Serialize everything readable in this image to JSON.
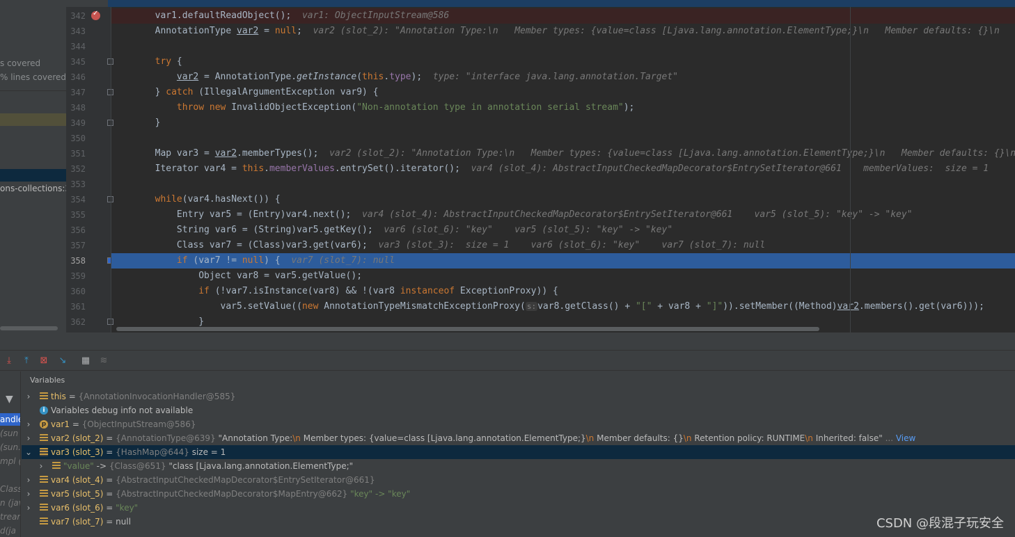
{
  "left_panel": {
    "coverage_lines": [
      "s covered",
      "% lines covered"
    ],
    "library_label": "ons-collections:3."
  },
  "editor": {
    "lines": [
      {
        "num": "342",
        "segments": [
          {
            "t": "        var1.defaultReadObject();  "
          },
          {
            "t": "var1: ObjectInputStream@586",
            "c": "hint"
          }
        ]
      },
      {
        "num": "343",
        "segments": [
          {
            "t": "        AnnotationType "
          },
          {
            "t": "var2",
            "c": "u"
          },
          {
            "t": " = "
          },
          {
            "t": "null",
            "c": "kw"
          },
          {
            "t": ";  "
          },
          {
            "t": "var2 (slot_2): \"Annotation Type:\\n   Member types: {value=class [Ljava.lang.annotation.ElementType;}\\n   Member defaults: {}\\n",
            "c": "hint"
          }
        ]
      },
      {
        "num": "344",
        "segments": [
          {
            "t": ""
          }
        ]
      },
      {
        "num": "345",
        "segments": [
          {
            "t": "        "
          },
          {
            "t": "try",
            "c": "kw"
          },
          {
            "t": " {"
          }
        ]
      },
      {
        "num": "346",
        "segments": [
          {
            "t": "            "
          },
          {
            "t": "var2",
            "c": "u"
          },
          {
            "t": " = AnnotationType."
          },
          {
            "t": "getInstance",
            "c": "ital"
          },
          {
            "t": "("
          },
          {
            "t": "this",
            "c": "kw"
          },
          {
            "t": "."
          },
          {
            "t": "type",
            "c": "field"
          },
          {
            "t": ");  "
          },
          {
            "t": "type: \"interface java.lang.annotation.Target\"",
            "c": "hint"
          }
        ]
      },
      {
        "num": "347",
        "segments": [
          {
            "t": "        } "
          },
          {
            "t": "catch",
            "c": "kw"
          },
          {
            "t": " (IllegalArgumentException var9) {"
          }
        ]
      },
      {
        "num": "348",
        "segments": [
          {
            "t": "            "
          },
          {
            "t": "throw new",
            "c": "kw"
          },
          {
            "t": " InvalidObjectException("
          },
          {
            "t": "\"Non-annotation type in annotation serial stream\"",
            "c": "str"
          },
          {
            "t": ");"
          }
        ]
      },
      {
        "num": "349",
        "segments": [
          {
            "t": "        }"
          }
        ]
      },
      {
        "num": "350",
        "segments": [
          {
            "t": ""
          }
        ]
      },
      {
        "num": "351",
        "segments": [
          {
            "t": "        Map var3 = "
          },
          {
            "t": "var2",
            "c": "u"
          },
          {
            "t": ".memberTypes();  "
          },
          {
            "t": "var2 (slot_2): \"Annotation Type:\\n   Member types: {value=class [Ljava.lang.annotation.ElementType;}\\n   Member defaults: {}\\n",
            "c": "hint"
          }
        ]
      },
      {
        "num": "352",
        "segments": [
          {
            "t": "        Iterator var4 = "
          },
          {
            "t": "this",
            "c": "kw"
          },
          {
            "t": "."
          },
          {
            "t": "memberValues",
            "c": "field"
          },
          {
            "t": ".entrySet().iterator();  "
          },
          {
            "t": "var4 (slot_4): AbstractInputCheckedMapDecorator$EntrySetIterator@661    memberValues:  size = 1",
            "c": "hint"
          }
        ]
      },
      {
        "num": "353",
        "segments": [
          {
            "t": ""
          }
        ]
      },
      {
        "num": "354",
        "segments": [
          {
            "t": "        "
          },
          {
            "t": "while",
            "c": "kw"
          },
          {
            "t": "(var4.hasNext()) {"
          }
        ]
      },
      {
        "num": "355",
        "segments": [
          {
            "t": "            Entry var5 = (Entry)var4.next();  "
          },
          {
            "t": "var4 (slot_4): AbstractInputCheckedMapDecorator$EntrySetIterator@661    var5 (slot_5): \"key\" -> \"key\"",
            "c": "hint"
          }
        ]
      },
      {
        "num": "356",
        "segments": [
          {
            "t": "            String var6 = (String)var5.getKey();  "
          },
          {
            "t": "var6 (slot_6): \"key\"    var5 (slot_5): \"key\" -> \"key\"",
            "c": "hint"
          }
        ]
      },
      {
        "num": "357",
        "segments": [
          {
            "t": "            Class var7 = (Class)var3.get(var6);  "
          },
          {
            "t": "var3 (slot_3):  size = 1    var6 (slot_6): \"key\"    var7 (slot_7): null",
            "c": "hint"
          }
        ]
      },
      {
        "num": "358",
        "segments": [
          {
            "t": "            "
          },
          {
            "t": "if",
            "c": "kw"
          },
          {
            "t": " (var7 != "
          },
          {
            "t": "null",
            "c": "kw"
          },
          {
            "t": ") {  "
          },
          {
            "t": "var7 (slot_7): null",
            "c": "hint"
          }
        ]
      },
      {
        "num": "359",
        "segments": [
          {
            "t": "                Object var8 = var5.getValue();"
          }
        ]
      },
      {
        "num": "360",
        "segments": [
          {
            "t": "                "
          },
          {
            "t": "if",
            "c": "kw"
          },
          {
            "t": " (!var7.isInstance(var8) && !(var8 "
          },
          {
            "t": "instanceof",
            "c": "kw"
          },
          {
            "t": " ExceptionProxy)) {"
          }
        ]
      },
      {
        "num": "361",
        "segments": [
          {
            "t": "                    var5.setValue(("
          },
          {
            "t": "new",
            "c": "kw"
          },
          {
            "t": " AnnotationTypeMismatchExceptionProxy("
          },
          {
            "t": "s:",
            "c": "param-hint"
          },
          {
            "t": "var8.getClass() + "
          },
          {
            "t": "\"[\"",
            "c": "str"
          },
          {
            "t": " + var8 + "
          },
          {
            "t": "\"]\"",
            "c": "str"
          },
          {
            "t": ")).setMember((Method)"
          },
          {
            "t": "var2",
            "c": "u"
          },
          {
            "t": ".members().get(var6)));"
          }
        ]
      },
      {
        "num": "362",
        "segments": [
          {
            "t": "                }"
          }
        ]
      }
    ]
  },
  "debugger": {
    "toolbar_icons": [
      "step-into-icon",
      "step-out-icon",
      "drop-frame-icon",
      "run-to-cursor-icon",
      "evaluate-table-icon",
      "trace-icon"
    ],
    "frames": {
      "selected": "andle",
      "items": [
        "(sun",
        "(sun.",
        "mpl (",
        "",
        "Class",
        "n (jav",
        "tream",
        "d(ja"
      ]
    },
    "variables_title": "Variables",
    "variables": [
      {
        "expander": "›",
        "icon": "field",
        "name": "this",
        "rest": [
          {
            "t": " = "
          },
          {
            "t": "{AnnotationInvocationHandler@585}",
            "c": "vtype"
          }
        ]
      },
      {
        "expander": "",
        "icon": "info",
        "name": "Variables debug info not available",
        "rest": []
      },
      {
        "expander": "›",
        "icon": "param",
        "name": "var1",
        "rest": [
          {
            "t": " = "
          },
          {
            "t": "{ObjectInputStream@586}",
            "c": "vtype"
          }
        ]
      },
      {
        "expander": "›",
        "icon": "field",
        "name": "var2 (slot_2)",
        "rest": [
          {
            "t": " = "
          },
          {
            "t": "{AnnotationType@639}",
            "c": "vtype"
          },
          {
            "t": " \"Annotation Type:",
            "c": "vval"
          },
          {
            "t": "\\n",
            "c": "vesc"
          },
          {
            "t": "   Member types: {value=class [Ljava.lang.annotation.ElementType;}",
            "c": "vval"
          },
          {
            "t": "\\n",
            "c": "vesc"
          },
          {
            "t": "   Member defaults: {}",
            "c": "vval"
          },
          {
            "t": "\\n",
            "c": "vesc"
          },
          {
            "t": "   Retention policy: RUNTIME",
            "c": "vval"
          },
          {
            "t": "\\n",
            "c": "vesc"
          },
          {
            "t": "   Inherited: false\"",
            "c": "vval"
          },
          {
            "t": " ... ",
            "c": "vtype"
          },
          {
            "t": "View",
            "c": "vlink"
          }
        ]
      },
      {
        "expander": "⌄",
        "icon": "field",
        "name": "var3 (slot_3)",
        "selected": true,
        "rest": [
          {
            "t": " = "
          },
          {
            "t": "{HashMap@644}",
            "c": "vtype"
          },
          {
            "t": "  size = 1",
            "c": "vval"
          }
        ]
      },
      {
        "expander": "›",
        "icon": "field",
        "name": "\"value\"",
        "indent": 1,
        "nameClass": "vstr",
        "rest": [
          {
            "t": " -> "
          },
          {
            "t": "{Class@651}",
            "c": "vtype"
          },
          {
            "t": " \"class [Ljava.lang.annotation.ElementType;\"",
            "c": "vval"
          }
        ]
      },
      {
        "expander": "›",
        "icon": "field",
        "name": "var4 (slot_4)",
        "rest": [
          {
            "t": " = "
          },
          {
            "t": "{AbstractInputCheckedMapDecorator$EntrySetIterator@661}",
            "c": "vtype"
          }
        ]
      },
      {
        "expander": "›",
        "icon": "field",
        "name": "var5 (slot_5)",
        "rest": [
          {
            "t": " = "
          },
          {
            "t": "{AbstractInputCheckedMapDecorator$MapEntry@662}",
            "c": "vtype"
          },
          {
            "t": " \"key\" -> \"key\"",
            "c": "vstr"
          }
        ]
      },
      {
        "expander": "›",
        "icon": "field",
        "name": "var6 (slot_6)",
        "rest": [
          {
            "t": " = "
          },
          {
            "t": "\"key\"",
            "c": "vstr"
          }
        ]
      },
      {
        "expander": "",
        "icon": "field",
        "name": "var7 (slot_7)",
        "rest": [
          {
            "t": " = "
          },
          {
            "t": "null",
            "c": "vval"
          }
        ]
      }
    ],
    "watermark": "CSDN @段混子玩安全"
  }
}
